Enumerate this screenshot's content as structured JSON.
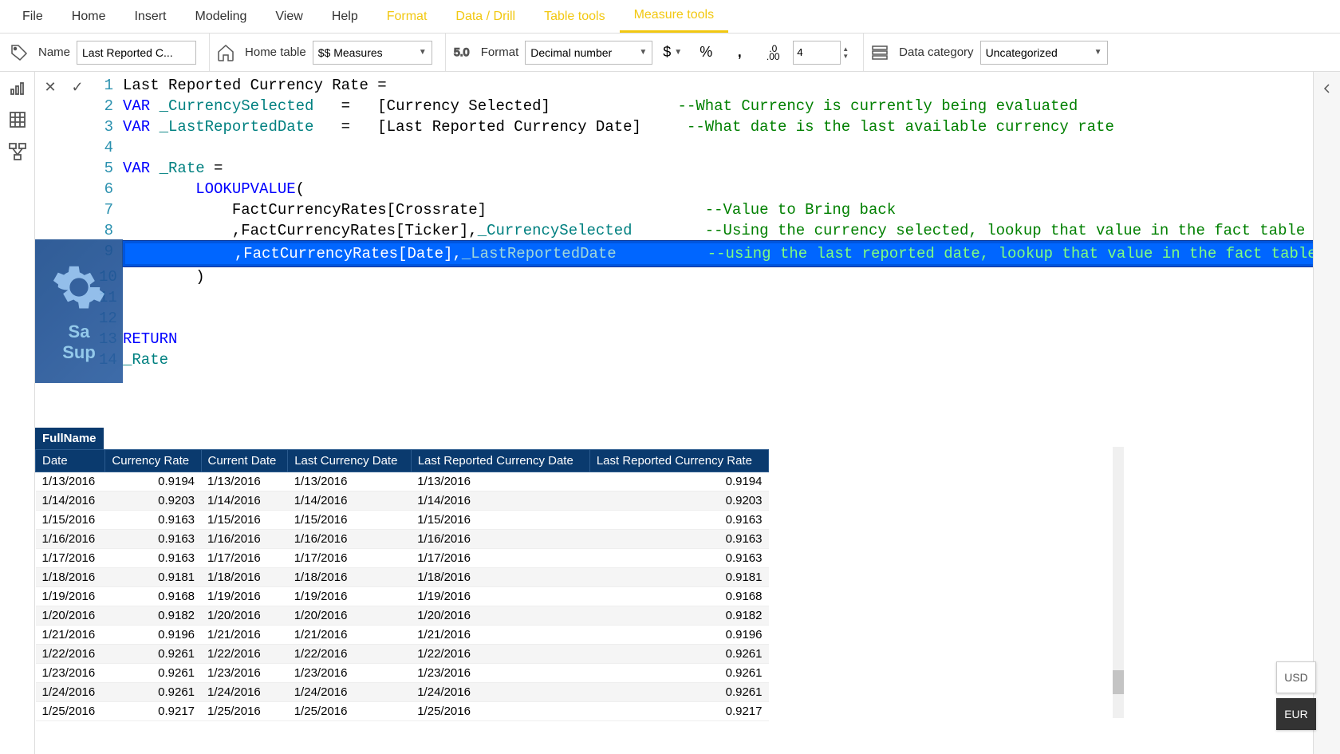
{
  "ribbon": {
    "tabs": [
      "File",
      "Home",
      "Insert",
      "Modeling",
      "View",
      "Help",
      "Format",
      "Data / Drill",
      "Table tools",
      "Measure tools"
    ],
    "active_tab": "Measure tools"
  },
  "toolbar": {
    "name_label": "Name",
    "name_value": "Last Reported C...",
    "home_table_label": "Home table",
    "home_table_value": "$$ Measures",
    "format_label": "Format",
    "format_value": "Decimal number",
    "decimals_value": "4",
    "data_category_label": "Data category",
    "data_category_value": "Uncategorized"
  },
  "formula": {
    "lines": [
      {
        "num": "1",
        "segments": [
          {
            "t": "",
            "c": "Last Reported Currency Rate = "
          }
        ]
      },
      {
        "num": "2",
        "segments": [
          {
            "t": "var",
            "c": "VAR"
          },
          {
            "t": "",
            "c": " "
          },
          {
            "t": "ident",
            "c": "_CurrencySelected"
          },
          {
            "t": "",
            "c": "   =   [Currency Selected]              "
          },
          {
            "t": "comment",
            "c": "--What Currency is currently being evaluated"
          }
        ]
      },
      {
        "num": "3",
        "segments": [
          {
            "t": "var",
            "c": "VAR"
          },
          {
            "t": "",
            "c": " "
          },
          {
            "t": "ident",
            "c": "_LastReportedDate"
          },
          {
            "t": "",
            "c": "   =   [Last Reported Currency Date]     "
          },
          {
            "t": "comment",
            "c": "--What date is the last available currency rate"
          }
        ]
      },
      {
        "num": "4",
        "segments": []
      },
      {
        "num": "5",
        "segments": [
          {
            "t": "var",
            "c": "VAR"
          },
          {
            "t": "",
            "c": " "
          },
          {
            "t": "ident",
            "c": "_Rate"
          },
          {
            "t": "",
            "c": " ="
          }
        ]
      },
      {
        "num": "6",
        "segments": [
          {
            "t": "",
            "c": "        "
          },
          {
            "t": "func",
            "c": "LOOKUPVALUE"
          },
          {
            "t": "",
            "c": "("
          }
        ]
      },
      {
        "num": "7",
        "segments": [
          {
            "t": "",
            "c": "            FactCurrencyRates[Crossrate]                        "
          },
          {
            "t": "comment",
            "c": "--Value to Bring back"
          }
        ]
      },
      {
        "num": "8",
        "segments": [
          {
            "t": "",
            "c": "            ,FactCurrencyRates[Ticker],"
          },
          {
            "t": "ident",
            "c": "_CurrencySelected"
          },
          {
            "t": "",
            "c": "        "
          },
          {
            "t": "comment",
            "c": "--Using the currency selected, lookup that value in the fact table"
          }
        ]
      },
      {
        "num": "9",
        "highlighted": true,
        "segments": [
          {
            "t": "",
            "c": "            ,FactCurrencyRates[Date],"
          },
          {
            "t": "ident",
            "c": "_LastReportedDate"
          },
          {
            "t": "",
            "c": "          "
          },
          {
            "t": "comment",
            "c": "--using the last reported date, lookup that value in the fact table"
          }
        ]
      },
      {
        "num": "10",
        "segments": [
          {
            "t": "",
            "c": "        )"
          }
        ]
      },
      {
        "num": "11",
        "segments": []
      },
      {
        "num": "12",
        "segments": []
      },
      {
        "num": "13",
        "segments": [
          {
            "t": "return",
            "c": "RETURN"
          }
        ]
      },
      {
        "num": "14",
        "segments": [
          {
            "t": "ident",
            "c": "_Rate"
          }
        ]
      }
    ]
  },
  "overlay": {
    "text1": "Sa",
    "text2": "Sup"
  },
  "table": {
    "title": "FullName",
    "columns": [
      "Date",
      "Currency Rate",
      "Current Date",
      "Last Currency Date",
      "Last Reported Currency Date",
      "Last Reported Currency Rate"
    ],
    "rows": [
      [
        "1/13/2016",
        "0.9194",
        "1/13/2016",
        "1/13/2016",
        "1/13/2016",
        "0.9194"
      ],
      [
        "1/14/2016",
        "0.9203",
        "1/14/2016",
        "1/14/2016",
        "1/14/2016",
        "0.9203"
      ],
      [
        "1/15/2016",
        "0.9163",
        "1/15/2016",
        "1/15/2016",
        "1/15/2016",
        "0.9163"
      ],
      [
        "1/16/2016",
        "0.9163",
        "1/16/2016",
        "1/16/2016",
        "1/16/2016",
        "0.9163"
      ],
      [
        "1/17/2016",
        "0.9163",
        "1/17/2016",
        "1/17/2016",
        "1/17/2016",
        "0.9163"
      ],
      [
        "1/18/2016",
        "0.9181",
        "1/18/2016",
        "1/18/2016",
        "1/18/2016",
        "0.9181"
      ],
      [
        "1/19/2016",
        "0.9168",
        "1/19/2016",
        "1/19/2016",
        "1/19/2016",
        "0.9168"
      ],
      [
        "1/20/2016",
        "0.9182",
        "1/20/2016",
        "1/20/2016",
        "1/20/2016",
        "0.9182"
      ],
      [
        "1/21/2016",
        "0.9196",
        "1/21/2016",
        "1/21/2016",
        "1/21/2016",
        "0.9196"
      ],
      [
        "1/22/2016",
        "0.9261",
        "1/22/2016",
        "1/22/2016",
        "1/22/2016",
        "0.9261"
      ],
      [
        "1/23/2016",
        "0.9261",
        "1/23/2016",
        "1/23/2016",
        "1/23/2016",
        "0.9261"
      ],
      [
        "1/24/2016",
        "0.9261",
        "1/24/2016",
        "1/24/2016",
        "1/24/2016",
        "0.9261"
      ],
      [
        "1/25/2016",
        "0.9217",
        "1/25/2016",
        "1/25/2016",
        "1/25/2016",
        "0.9217"
      ]
    ]
  },
  "slicer": {
    "options": [
      "USD",
      "EUR"
    ],
    "selected": "EUR"
  }
}
